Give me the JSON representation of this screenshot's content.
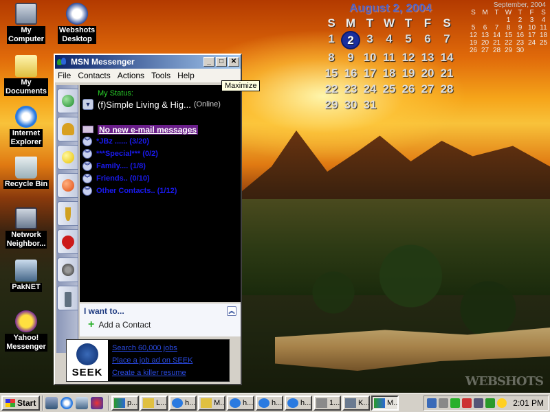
{
  "desktop": {
    "icons": [
      {
        "label_lines": [
          "My",
          "Computer"
        ]
      },
      {
        "label_lines": [
          "Webshots",
          "Desktop"
        ]
      },
      {
        "label_lines": [
          "My",
          "Documents"
        ]
      },
      {
        "label_lines": [
          "Internet",
          "Explorer"
        ]
      },
      {
        "label_lines": [
          "Recycle Bin"
        ]
      },
      {
        "label_lines": [
          "Network",
          "Neighbor..."
        ]
      },
      {
        "label_lines": [
          "PakNET"
        ]
      },
      {
        "label_lines": [
          "Yahoo!",
          "Messenger"
        ]
      }
    ],
    "watermark": "WEBSHOTS"
  },
  "calendar_big": {
    "title": "August 2, 2004",
    "days": [
      "S",
      "M",
      "T",
      "W",
      "T",
      "F",
      "S"
    ],
    "dates": [
      "1",
      "2",
      "3",
      "4",
      "5",
      "6",
      "7",
      "8",
      "9",
      "10",
      "11",
      "12",
      "13",
      "14",
      "15",
      "16",
      "17",
      "18",
      "19",
      "20",
      "21",
      "22",
      "23",
      "24",
      "25",
      "26",
      "27",
      "28",
      "29",
      "30",
      "31"
    ],
    "today": "2"
  },
  "calendar_small": {
    "title": "September, 2004",
    "days": [
      "S",
      "M",
      "T",
      "W",
      "T",
      "F",
      "S"
    ],
    "cells": [
      "",
      "",
      "",
      "1",
      "2",
      "3",
      "4",
      "5",
      "6",
      "7",
      "8",
      "9",
      "10",
      "11",
      "12",
      "13",
      "14",
      "15",
      "16",
      "17",
      "18",
      "19",
      "20",
      "21",
      "22",
      "23",
      "24",
      "25",
      "26",
      "27",
      "28",
      "29",
      "30",
      "",
      ""
    ]
  },
  "msn": {
    "title": "MSN Messenger",
    "menu": [
      "File",
      "Contacts",
      "Actions",
      "Tools",
      "Help"
    ],
    "my_status_label": "My Status:",
    "status_name": "(f)Simple Living & Hig...",
    "status_state": "(Online)",
    "email": "No new e-mail messages",
    "groups": [
      "*JBz ...... (3/20)",
      "***Special*** (0/2)",
      "Family.... (1/8)",
      "Friends.. (0/10)",
      "Other Contacts.. (1/12)"
    ],
    "iwant": "I want to...",
    "add_contact": "Add a Contact",
    "ad_logo": "SEEK",
    "ad_links": [
      "Search 60,000 jobs",
      "Place a job ad on SEEK",
      "Create a killer resume"
    ]
  },
  "tooltip": "Maximize",
  "taskbar": {
    "start": "Start",
    "tasks": [
      "p...",
      "L...",
      "h...",
      "M...",
      "h...",
      "h...",
      "h...",
      "1...",
      "K...",
      "M..."
    ],
    "clock": "2:01 PM"
  }
}
